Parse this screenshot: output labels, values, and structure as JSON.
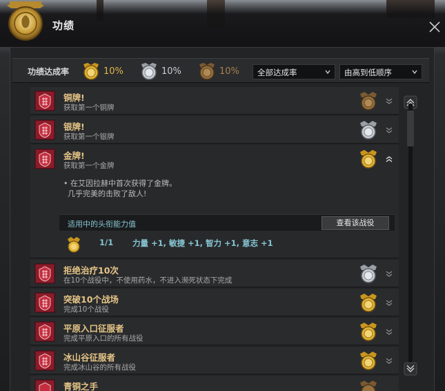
{
  "window": {
    "title": "功绩"
  },
  "filter": {
    "label": "功绩达成率",
    "gold_pct": "10%",
    "silver_pct": "10%",
    "bronze_pct": "10%",
    "category_select": "全部达成率",
    "sort_select": "由高到低顺序"
  },
  "achievements": [
    {
      "name": "铜牌!",
      "desc": "获取第一个铜牌",
      "medal": "bronze",
      "expanded": false
    },
    {
      "name": "银牌!",
      "desc": "获取第一个银牌",
      "medal": "silver",
      "expanded": false
    },
    {
      "name": "金牌!",
      "desc": "获取第一个金牌",
      "medal": "gold",
      "expanded": true
    },
    {
      "name": "拒绝治疗10次",
      "desc": "在10个战役中，不使用药水，不进入濒死状态下完成",
      "medal": "silver",
      "expanded": false
    },
    {
      "name": "突破10个战场",
      "desc": "完成10个战役",
      "medal": "gold",
      "expanded": false
    },
    {
      "name": "平原入口征服者",
      "desc": "完成平原入口的所有战役",
      "medal": "gold",
      "expanded": false
    },
    {
      "name": "冰山谷征服者",
      "desc": "完成冰山谷的所有战役",
      "medal": "gold",
      "expanded": false
    },
    {
      "name": "青铜之手",
      "desc": "",
      "medal": "bronze",
      "expanded": false
    }
  ],
  "expanded_detail": {
    "text_line1": "• 在艾因拉赫中首次获得了金牌。",
    "text_line2": "几乎完美的击败了敌人!",
    "ability_title": "适用中的头衔能力值",
    "view_campaign_button": "查看该战役",
    "ability_count": "1/1",
    "ability_stats": "力量 +1, 敏捷 +1, 智力 +1, 意志 +1"
  },
  "colors": {
    "gold": "#d7a92a",
    "silver": "#b7bcc4",
    "bronze": "#8c6a3e",
    "badge_red": "#9b1f2e",
    "accent_text": "#86c6d4",
    "title_text": "#e6c687"
  },
  "icons": {
    "close": "close-icon",
    "chevron_down": "chevron-down-icon",
    "chevron_up": "chevron-up-icon",
    "scroll_up": "scroll-up-icon",
    "scroll_down": "scroll-down-icon",
    "badge": "achievement-badge-icon",
    "medal": "medal-icon"
  }
}
